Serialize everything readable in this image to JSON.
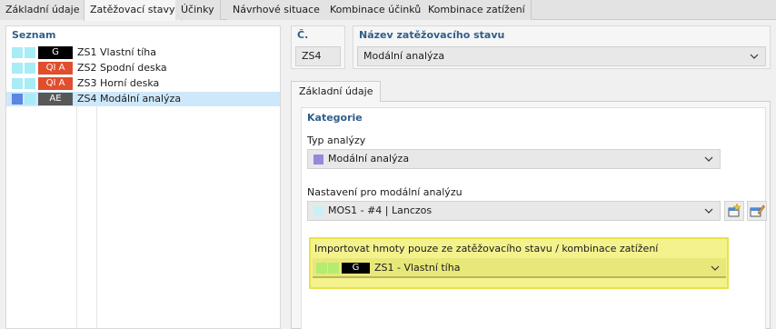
{
  "tabs": [
    {
      "label": "Základní údaje",
      "active": false
    },
    {
      "label": "Zatěžovací stavy",
      "active": true
    },
    {
      "label": "Účinky",
      "active": false
    },
    {
      "label": "Návrhové situace",
      "active": false
    },
    {
      "label": "Kombinace účinků",
      "active": false
    },
    {
      "label": "Kombinace zatížení",
      "active": false
    }
  ],
  "list": {
    "title": "Seznam",
    "items": [
      {
        "badge": "G",
        "badge_color": "#000000",
        "sq1": "#a8ecf5",
        "sq2": "#a8ecf5",
        "text": "ZS1  Vlastní tíha",
        "selected": false
      },
      {
        "badge": "QI A",
        "badge_color": "#e04e2e",
        "sq1": "#a8ecf5",
        "sq2": "#a8ecf5",
        "text": "ZS2  Spodní deska",
        "selected": false
      },
      {
        "badge": "QI A",
        "badge_color": "#e04e2e",
        "sq1": "#a8ecf5",
        "sq2": "#a8ecf5",
        "text": "ZS3  Horní deska",
        "selected": false
      },
      {
        "badge": "AE",
        "badge_color": "#585858",
        "sq1": "#5b87e0",
        "sq2": "#a8ecf5",
        "text": "ZS4  Modální analýza",
        "selected": true
      }
    ]
  },
  "number": {
    "label": "Č.",
    "value": "ZS4"
  },
  "name": {
    "label": "Název zatěžovacího stavu",
    "value": "Modální analýza"
  },
  "subtab": "Základní údaje",
  "category": {
    "title": "Kategorie",
    "analysis_type_label": "Typ analýzy",
    "analysis_type_value": "Modální analýza",
    "analysis_type_color": "#9b86dc",
    "modal_settings_label": "Nastavení pro modální analýzu",
    "modal_settings_value": "MOS1 - #4 | Lanczos",
    "modal_settings_color": "#c9f0f7"
  },
  "import_mass": {
    "title": "Importovat hmoty pouze ze zatěžovacího stavu / kombinace zatížení",
    "badge": "G",
    "value": "ZS1 - Vlastní tíha",
    "sq_color": "#b4ec6f"
  },
  "icons": {
    "chevron": "chevron-down-icon",
    "new": "new-item-icon",
    "edit": "edit-item-icon"
  }
}
